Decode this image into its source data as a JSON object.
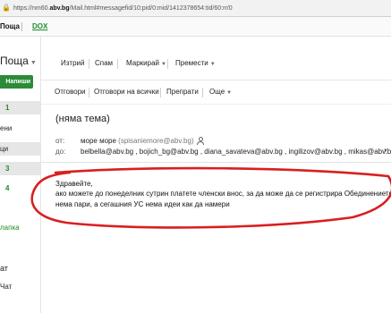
{
  "address_bar": {
    "url_prefix": "https://nm60.",
    "url_host": "abv.bg",
    "url_rest": "/Mail.html#messagefid/10:pid/0:mid/1412378654:tid/60:rr/0"
  },
  "top_strip": {
    "mail_tab": "Поща",
    "dox_link": "DOX"
  },
  "sidebar": {
    "title": "Поща",
    "compose": "Напиши",
    "items": [
      {
        "label": "1",
        "kind": "count"
      },
      {
        "label": "ени",
        "kind": "text"
      },
      {
        "label": "ци",
        "kind": "text"
      },
      {
        "label": "3",
        "kind": "count"
      },
      {
        "label": "4",
        "kind": "count"
      },
      {
        "label": "лапка",
        "kind": "green"
      },
      {
        "label": "ат",
        "kind": "text"
      },
      {
        "label": "Чат",
        "kind": "text"
      }
    ]
  },
  "toolbar_primary": {
    "delete": "Изтрий",
    "spam": "Спам",
    "mark": "Маркирай",
    "move": "Премести"
  },
  "toolbar_secondary": {
    "reply": "Отговори",
    "reply_all": "Отговори на всички",
    "forward": "Препрати",
    "more": "Още"
  },
  "message": {
    "subject": "(няма тема)",
    "from_label": "от:",
    "from_name": "море море",
    "from_email": "(spisaniemore@abv.bg)",
    "to_label": "до:",
    "to_list": "belbella@abv.bg , bojich_bg@abv.bg , diana_savateva@abv.bg , ingilizov@abv.bg , mikas@abv.bg ,",
    "body": [
      "Здравейте,",
      "ако можете до понеделник сутрин платете членски внос, за да може да се регистрира Обединението;",
      "нема пари, а сегашния УС нема идеи как да намери"
    ]
  },
  "colors": {
    "accent_green": "#2c8a39",
    "annotation_red": "#d91f1f"
  },
  "icons": [
    "lock-icon",
    "person-icon",
    "chevron-down-icon"
  ]
}
